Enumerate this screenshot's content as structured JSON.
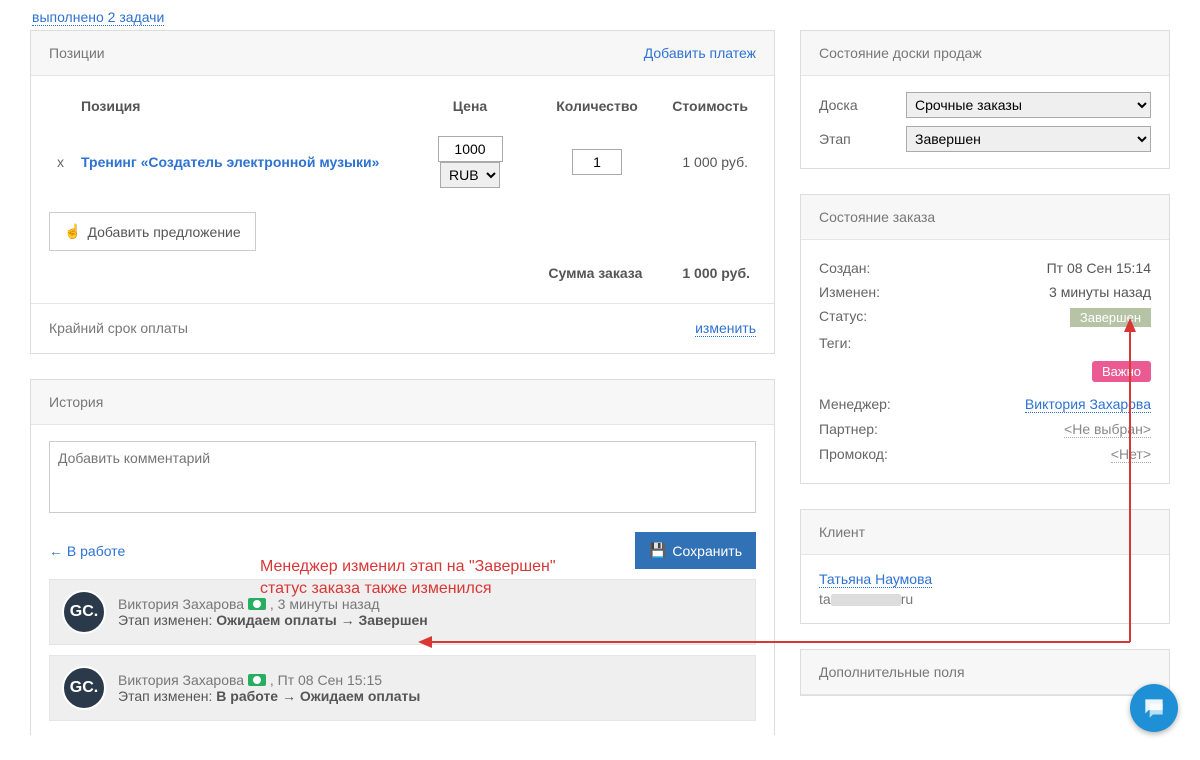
{
  "top_link": "выполнено 2 задачи",
  "positions": {
    "title": "Позиции",
    "add_payment": "Добавить платеж",
    "col_position": "Позиция",
    "col_price": "Цена",
    "col_qty": "Количество",
    "col_cost": "Стоимость",
    "item_name": "Тренинг «Создатель электронной музыки»",
    "item_price": "1000",
    "item_currency": "RUB",
    "item_qty": "1",
    "item_cost": "1 000 руб.",
    "add_offer": "Добавить предложение",
    "sum_label": "Сумма заказа",
    "sum_value": "1 000 руб.",
    "deadline_label": "Крайний срок оплаты",
    "change": "изменить"
  },
  "history": {
    "title": "История",
    "comment_placeholder": "Добавить комментарий",
    "back": "← В работе",
    "save": "Сохранить",
    "entries": [
      {
        "user": "Виктория Захарова",
        "time": "3 минуты назад",
        "line": "Этап изменен:",
        "from": "Ожидаем оплаты",
        "to": "Завершен"
      },
      {
        "user": "Виктория Захарова",
        "time": "Пт 08 Сен 15:15",
        "line": "Этап изменен:",
        "from": "В работе",
        "to": "Ожидаем оплаты"
      }
    ]
  },
  "board": {
    "title": "Состояние доски продаж",
    "board_label": "Доска",
    "board_value": "Срочные заказы",
    "stage_label": "Этап",
    "stage_value": "Завершен"
  },
  "order": {
    "title": "Состояние заказа",
    "created_l": "Создан:",
    "created_v": "Пт 08 Сен 15:14",
    "changed_l": "Изменен:",
    "changed_v": "3 минуты назад",
    "status_l": "Статус:",
    "status_v": "Завершен",
    "tags_l": "Теги:",
    "tag_v": "Важно",
    "manager_l": "Менеджер:",
    "manager_v": "Виктория Захарова",
    "partner_l": "Партнер:",
    "partner_v": "<Не выбран>",
    "promo_l": "Промокод:",
    "promo_v": "<Нет>"
  },
  "client": {
    "title": "Клиент",
    "name": "Татьяна Наумова",
    "email_pre": "ta",
    "email_post": "ru"
  },
  "extra": {
    "title": "Дополнительные поля"
  },
  "annotation_l1": "Менеджер изменил этап на \"Завершен\"",
  "annotation_l2": "статус заказа также изменился",
  "avatar_text": "GC."
}
